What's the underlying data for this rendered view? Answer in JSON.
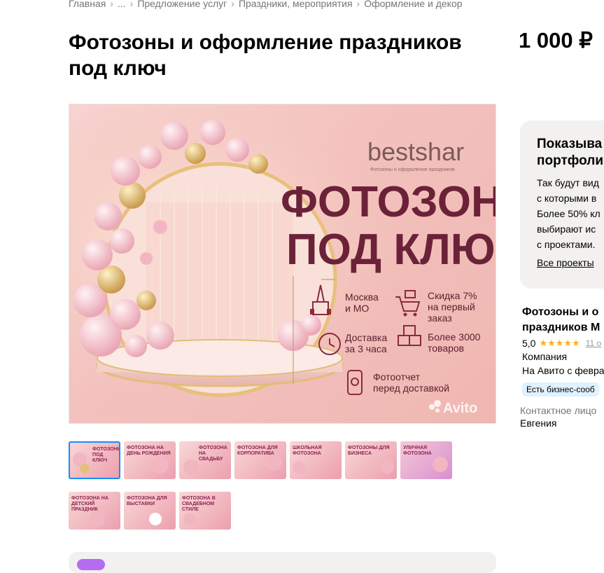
{
  "breadcrumbs": [
    "Главная",
    "...",
    "Предложение услуг",
    "Праздники, мероприятия",
    "Оформление и декор"
  ],
  "title": "Фотозоны и оформление праздников под ключ",
  "price": "1 000 ₽",
  "main_image": {
    "logo": "bestshar",
    "logo_sub": "Фотозоны и оформление праздников",
    "headline_1": "ФОТОЗОНЫ",
    "headline_2": "ПОД КЛЮЧ",
    "features": [
      {
        "icon": "kremlin-icon",
        "line1": "Москва",
        "line2": "и МО",
        "line3": ""
      },
      {
        "icon": "cart-icon",
        "line1": "Скидка 7%",
        "line2": "на первый",
        "line3": "заказ"
      },
      {
        "icon": "clock-icon",
        "line1": "Доставка",
        "line2": "за 3 часа",
        "line3": ""
      },
      {
        "icon": "boxes-icon",
        "line1": "Более 3000",
        "line2": "товаров",
        "line3": ""
      },
      {
        "icon": "phone-photo-icon",
        "line1": "Фотоотчет",
        "line2": "перед доставкой",
        "line3": ""
      }
    ],
    "watermark": "Avito"
  },
  "thumbnails": [
    {
      "label": "ФОТОЗОНЫ ПОД КЛЮЧ",
      "active": true
    },
    {
      "label": "ФОТОЗОНА НА ДЕНЬ РОЖДЕНИЯ",
      "active": false
    },
    {
      "label": "ФОТОЗОНА НА СВАДЬБУ",
      "active": false
    },
    {
      "label": "ФОТОЗОНА ДЛЯ КОРПОРАТИВА",
      "active": false
    },
    {
      "label": "ШКОЛЬНАЯ ФОТОЗОНА",
      "active": false
    },
    {
      "label": "ФОТОЗОНЫ ДЛЯ БИЗНЕСА",
      "active": false
    },
    {
      "label": "УЛИЧНАЯ ФОТОЗОНА",
      "active": false
    },
    {
      "label": "ФОТОЗОНА НА ДЕТСКИЙ ПРАЗДНИК",
      "active": false
    },
    {
      "label": "ФОТОЗОНА ДЛЯ ВЫСТАВКИ",
      "active": false
    },
    {
      "label": "ФОТОЗОНА В СВАДЕБНОМ СТИЛЕ",
      "active": false
    }
  ],
  "portfolio": {
    "title": "Показыва\nпортфоли",
    "text": "Так будут вид\nс которыми в\nБолее 50% кл\nвыбирают ис\nс проектами.",
    "link": "Все проекты"
  },
  "seller": {
    "name": "Фотозоны и о\nпраздников М",
    "rating": "5,0",
    "stars": "★★★★★",
    "reviews": "11 о",
    "type": "Компания",
    "since": "На Авито с февра",
    "badge": "Есть бизнес-сооб"
  },
  "contact": {
    "label": "Контактное лицо",
    "name": "Евгения"
  }
}
